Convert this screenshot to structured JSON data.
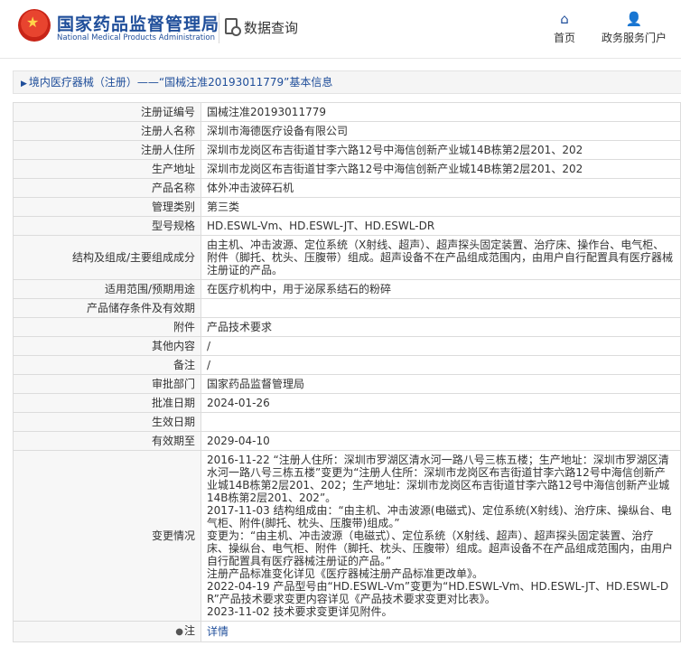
{
  "header": {
    "brand_cn": "国家药品监督管理局",
    "brand_en": "National Medical Products Administration",
    "data_query": "数据查询",
    "nav_home": "首页",
    "nav_service": "政务服务门户"
  },
  "breadcrumb": {
    "text": "境内医疗器械（注册）——“国械注准20193011779”基本信息"
  },
  "rows": [
    {
      "label": "注册证编号",
      "value": "国械注准20193011779"
    },
    {
      "label": "注册人名称",
      "value": "深圳市海德医疗设备有限公司"
    },
    {
      "label": "注册人住所",
      "value": "深圳市龙岗区布吉街道甘李六路12号中海信创新产业城14B栋第2层201、202"
    },
    {
      "label": "生产地址",
      "value": "深圳市龙岗区布吉街道甘李六路12号中海信创新产业城14B栋第2层201、202"
    },
    {
      "label": "产品名称",
      "value": "体外冲击波碎石机"
    },
    {
      "label": "管理类别",
      "value": "第三类"
    },
    {
      "label": "型号规格",
      "value": "HD.ESWL-Vm、HD.ESWL-JT、HD.ESWL-DR"
    },
    {
      "label": "结构及组成/主要组成成分",
      "value": "由主机、冲击波源、定位系统（X射线、超声）、超声探头固定装置、治疗床、操作台、电气柜、附件（脚托、枕头、压腹带）组成。超声设备不在产品组成范围内，由用户自行配置具有医疗器械注册证的产品。"
    },
    {
      "label": "适用范围/预期用途",
      "value": "在医疗机构中，用于泌尿系结石的粉碎"
    },
    {
      "label": "产品储存条件及有效期",
      "value": ""
    },
    {
      "label": "附件",
      "value": "产品技术要求"
    },
    {
      "label": "其他内容",
      "value": "/"
    },
    {
      "label": "备注",
      "value": "/"
    },
    {
      "label": "审批部门",
      "value": "国家药品监督管理局"
    },
    {
      "label": "批准日期",
      "value": "2024-01-26"
    },
    {
      "label": "生效日期",
      "value": ""
    },
    {
      "label": "有效期至",
      "value": "2029-04-10"
    },
    {
      "label": "变更情况",
      "value": "2016-11-22 “注册人住所：深圳市罗湖区清水河一路八号三栋五楼；生产地址：深圳市罗湖区清水河一路八号三栋五楼”变更为“注册人住所：深圳市龙岗区布吉街道甘李六路12号中海信创新产业城14B栋第2层201、202；生产地址：深圳市龙岗区布吉街道甘李六路12号中海信创新产业城14B栋第2层201、202”。\n2017-11-03 结构组成由：“由主机、冲击波源(电磁式)、定位系统(X射线)、治疗床、操纵台、电气柜、附件(脚托、枕头、压腹带)组成。”\n变更为：“由主机、冲击波源（电磁式）、定位系统（X射线、超声）、超声探头固定装置、治疗床、操纵台、电气柜、附件（脚托、枕头、压腹带）组成。超声设备不在产品组成范围内，由用户自行配置具有医疗器械注册证的产品。”\n注册产品标准变化详见《医疗器械注册产品标准更改单》。\n2022-04-19 产品型号由“HD.ESWL-Vm”变更为“HD.ESWL-Vm、HD.ESWL-JT、HD.ESWL-DR”产品技术要求变更内容详见《产品技术要求变更对比表》。\n2023-11-02 技术要求变更详见附件。"
    }
  ],
  "note": {
    "label": "注",
    "link": "详情"
  }
}
